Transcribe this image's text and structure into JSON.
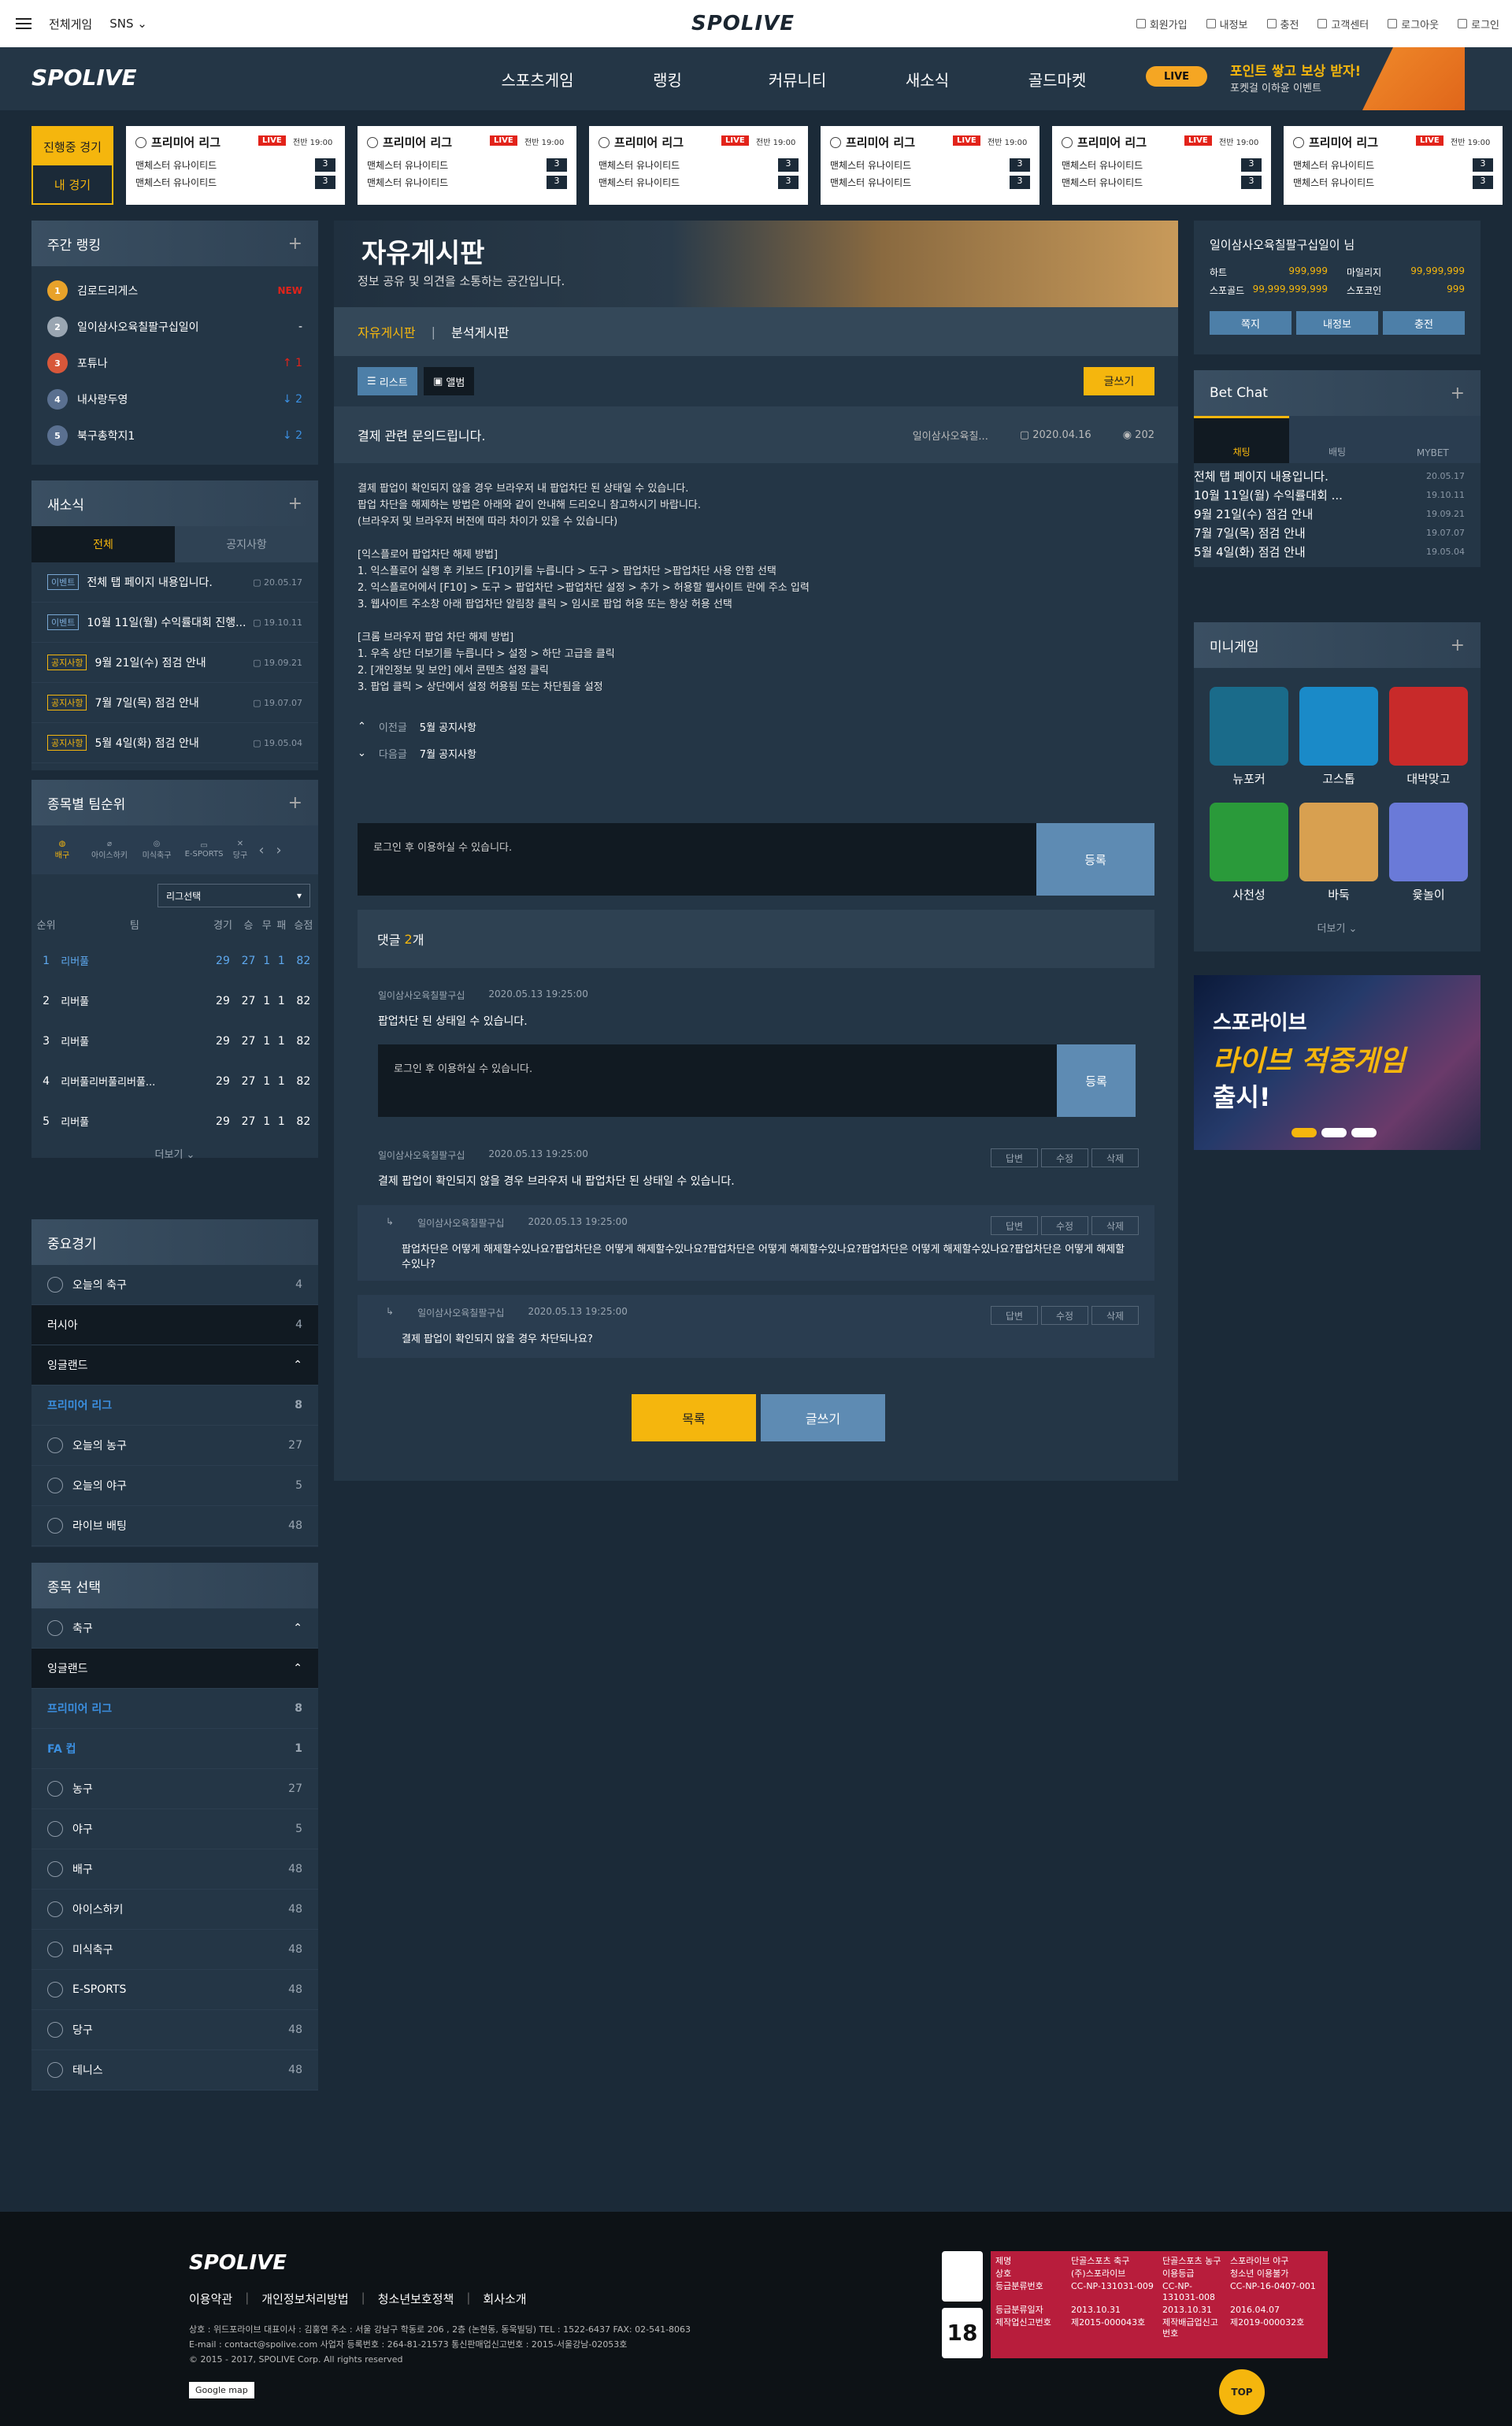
{
  "header": {
    "menu_all": "전체게임",
    "menu_sns": "SNS",
    "logo": "SPOLIVE",
    "links": [
      "회원가입",
      "내정보",
      "충전",
      "고객센터",
      "로그아웃",
      "로그인"
    ]
  },
  "nav": {
    "logo": "SPOLIVE",
    "items": [
      "스포츠게임",
      "랭킹",
      "커뮤니티",
      "새소식",
      "골드마켓"
    ],
    "live": "LIVE",
    "promo_title": "포인트 쌓고 보상 받자!",
    "promo_sub": "포켓걸 이하윤 이벤트"
  },
  "livegames": {
    "tab_live": "진행중 경기",
    "tab_mine": "내 경기",
    "cards": [
      {
        "league": "프리미어 리그",
        "live": "LIVE",
        "time": "전반 19:00",
        "home": "맨체스터 유나이티드",
        "away": "맨체스터 유나이티드",
        "hs": "3",
        "as": "3"
      },
      {
        "league": "프리미어 리그",
        "live": "LIVE",
        "time": "전반 19:00",
        "home": "맨체스터 유나이티드",
        "away": "맨체스터 유나이티드",
        "hs": "3",
        "as": "3"
      },
      {
        "league": "프리미어 리그",
        "live": "LIVE",
        "time": "전반 19:00",
        "home": "맨체스터 유나이티드",
        "away": "맨체스터 유나이티드",
        "hs": "3",
        "as": "3"
      },
      {
        "league": "프리미어 리그",
        "live": "LIVE",
        "time": "전반 19:00",
        "home": "맨체스터 유나이티드",
        "away": "맨체스터 유나이티드",
        "hs": "3",
        "as": "3"
      },
      {
        "league": "프리미어 리그",
        "live": "LIVE",
        "time": "전반 19:00",
        "home": "맨체스터 유나이티드",
        "away": "맨체스터 유나이티드",
        "hs": "3",
        "as": "3"
      },
      {
        "league": "프리미어 리그",
        "live": "LIVE",
        "time": "전반 19:00",
        "home": "맨체스터 유나이티드",
        "away": "맨체스터 유나이티드",
        "hs": "3",
        "as": "3"
      }
    ]
  },
  "weekly": {
    "title": "주간 랭킹",
    "rows": [
      {
        "n": "1",
        "name": "김로드리게스",
        "ch": "NEW"
      },
      {
        "n": "2",
        "name": "일이삼사오육칠팔구십일이",
        "ch": "-"
      },
      {
        "n": "3",
        "name": "포튜나",
        "ch": "↑ 1"
      },
      {
        "n": "4",
        "name": "내사랑두영",
        "ch": "↓ 2"
      },
      {
        "n": "5",
        "name": "북구총학지1",
        "ch": "↓ 2"
      }
    ]
  },
  "news": {
    "title": "새소식",
    "tab_all": "전체",
    "tab_notice": "공지사항",
    "rows": [
      {
        "badge": "이벤트",
        "title": "전체 탭 페이지 내용입니다.",
        "date": "20.05.17"
      },
      {
        "badge": "이벤트",
        "title": "10월 11일(월) 수익률대회 진행...",
        "date": "19.10.11"
      },
      {
        "badge": "공지사항",
        "title": "9월 21일(수) 점검 안내",
        "date": "19.09.21"
      },
      {
        "badge": "공지사항",
        "title": "7월 7일(목) 점검 안내",
        "date": "19.07.07"
      },
      {
        "badge": "공지사항",
        "title": "5월 4일(화) 점검 안내",
        "date": "19.05.04"
      }
    ]
  },
  "teamrank": {
    "title": "종목별 팀순위",
    "sports": [
      "배구",
      "아이스하키",
      "미식축구",
      "E-SPORTS",
      "당구"
    ],
    "select": "리그선택",
    "cols": [
      "순위",
      "팀",
      "경기",
      "승",
      "무",
      "패",
      "승점"
    ],
    "rows": [
      [
        "1",
        "리버풀",
        "29",
        "27",
        "1",
        "1",
        "82"
      ],
      [
        "2",
        "리버풀",
        "29",
        "27",
        "1",
        "1",
        "82"
      ],
      [
        "3",
        "리버풀",
        "29",
        "27",
        "1",
        "1",
        "82"
      ],
      [
        "4",
        "리버풀리버풀리버풀...",
        "29",
        "27",
        "1",
        "1",
        "82"
      ],
      [
        "5",
        "리버풀",
        "29",
        "27",
        "1",
        "1",
        "82"
      ]
    ],
    "more": "더보기"
  },
  "important": {
    "title": "중요경기",
    "rows": [
      {
        "n": "오늘의 축구",
        "c": "4"
      },
      {
        "n": "러시아",
        "c": "4"
      },
      {
        "n": "잉글랜드",
        "c": ""
      },
      {
        "n": "프리미어 리그",
        "c": "8"
      },
      {
        "n": "오늘의 농구",
        "c": "27"
      },
      {
        "n": "오늘의 야구",
        "c": "5"
      },
      {
        "n": "라이브 배팅",
        "c": "48"
      }
    ]
  },
  "sportsel": {
    "title": "종목 선택",
    "rows": [
      {
        "n": "축구",
        "c": ""
      },
      {
        "n": "잉글랜드",
        "c": ""
      },
      {
        "n": "프리미어 리그",
        "c": "8"
      },
      {
        "n": "FA 컵",
        "c": "1"
      },
      {
        "n": "농구",
        "c": "27"
      },
      {
        "n": "야구",
        "c": "5"
      },
      {
        "n": "배구",
        "c": "48"
      },
      {
        "n": "아이스하키",
        "c": "48"
      },
      {
        "n": "미식축구",
        "c": "48"
      },
      {
        "n": "E-SPORTS",
        "c": "48"
      },
      {
        "n": "당구",
        "c": "48"
      },
      {
        "n": "테니스",
        "c": "48"
      }
    ]
  },
  "board": {
    "title": "자유게시판",
    "desc": "정보 공유 및 의견을 소통하는 공간입니다.",
    "tab1": "자유게시판",
    "tab2": "분석게시판",
    "list": "리스트",
    "album": "앨범",
    "write": "글쓰기",
    "post_title": "결제 관련 문의드립니다.",
    "post_author": "일이삼사오육칠...",
    "post_date": "2020.04.16",
    "post_views": "202",
    "body": "결제 팝업이 확인되지 않을 경우 브라우저 내 팝업차단 된 상태일 수 있습니다.\n팝업 차단을 해제하는 방법은 아래와 같이 안내해 드리오니 참고하시기 바랍니다.\n(브라우저 및 브라우저 버전에 따라 차이가 있을 수 있습니다)\n\n[익스플로어 팝업차단 해제 방법]\n1. 익스플로어 실행 후 키보드 [F10]키를 누릅니다 > 도구 > 팝업차단 >팝업차단 사용 안함 선택\n2. 익스플로어에서 [F10] > 도구 > 팝업차단 >팝업차단 설정 > 추가 > 허용할 웹사이트 란에 주소 입력\n3. 웹사이트 주소창 아래 팝업차단 알림창 클릭 > 임시로 팝업 허용 또는 항상 허용 선택\n\n[크롬 브라우저 팝업 차단 해제 방법]\n1. 우측 상단 더보기를 누릅니다 > 설정 > 하단 고급을 클릭\n2. [개인정보 및 보안] 에서 콘텐츠 설정 클릭\n3. 팝업 클릭 > 상단에서 설정 허용됨 또는 차단됨을 설정",
    "prev_k": "이전글",
    "prev": "5월 공지사항",
    "next_k": "다음글",
    "next": "7월 공지사항",
    "cmt_ph": "로그인 후 이용하실 수 있습니다.",
    "cmt_btn": "등록",
    "cmt_label": "댓글",
    "cmt_n": "2",
    "cmt_unit": "개",
    "c1_author": "일이삼사오육칠팔구십",
    "c1_date": "2020.05.13 19:25:00",
    "c1_text": "팝업차단 된 상태일 수 있습니다.",
    "c2_author": "일이삼사오육칠팔구십",
    "c2_date": "2020.05.13 19:25:00",
    "c2_text": "결제 팝업이 확인되지 않을 경우 브라우저 내 팝업차단 된 상태일 수 있습니다.",
    "c3_author": "일이삼사오육칠팔구십",
    "c3_date": "2020.05.13 19:25:00",
    "c3_text": "팝업차단은 어떻게 해제할수있나요?팝업차단은 어떻게 해제할수있나요?팝업차단은 어떻게 해제할수있나요?팝업차단은 어떻게 해제할수있나요?팝업차단은 어떻게 해제할 수있나?",
    "c4_author": "일이삼사오육칠팔구십",
    "c4_date": "2020.05.13 19:25:00",
    "c4_text": "결제 팝업이 확인되지 않을 경우 차단되나요?",
    "b_reply": "답변",
    "b_edit": "수정",
    "b_del": "삭제",
    "btn_list": "목록",
    "btn_write": "글쓰기"
  },
  "user": {
    "name": "일이삼사오육칠팔구십일이 님",
    "p1k": "하트",
    "p1": "999,999",
    "p2k": "마일리지",
    "p2": "99,999,999",
    "p3k": "스포골드",
    "p3": "99,999,999,999",
    "p4k": "스포코인",
    "p4": "999",
    "btns": [
      "쪽지",
      "내정보",
      "충전"
    ]
  },
  "betchat": {
    "title": "Bet Chat",
    "tabs": [
      "채팅",
      "배팅",
      "MYBET"
    ],
    "rows": [
      {
        "t": "전체 탭 페이지 내용입니다.",
        "d": "20.05.17"
      },
      {
        "t": "10월 11일(월) 수익률대회 ...",
        "d": "19.10.11"
      },
      {
        "t": "9월 21일(수) 점검 안내",
        "d": "19.09.21"
      },
      {
        "t": "7월 7일(목) 점검 안내",
        "d": "19.07.07"
      },
      {
        "t": "5월 4일(화) 점검 안내",
        "d": "19.05.04"
      }
    ]
  },
  "minigame": {
    "title": "미니게임",
    "items": [
      "뉴포커",
      "고스톱",
      "대박맞고",
      "사천성",
      "바둑",
      "윷놀이"
    ],
    "more": "더보기",
    "colors": [
      "#1a6b8a",
      "#1a8ac8",
      "#c82a2a",
      "#2a9a3a",
      "#d8a050",
      "#6a7ad8"
    ]
  },
  "ad": {
    "t1": "스포라이브",
    "t2": "라이브 적중게임",
    "t3": "출시!"
  },
  "footer": {
    "logo": "SPOLIVE",
    "links": [
      "이용약관",
      "개인정보처리방법",
      "청소년보호정책",
      "회사소개"
    ],
    "info1": "상호 : 위드포라이브 대표이사 : 김홍연 주소 : 서울 강남구 학동로 206 , 2층 (논현동, 동욱빌딩) TEL : 1522-6437 FAX: 02-541-8063",
    "info2": "E-mail : contact@spolive.com 사업자 등록번호 : 264-81-21573 통신판매업신고번호 : 2015-서울강남-02053호",
    "info3": "© 2015 - 2017, SPOLIVE Corp. All rights reserved",
    "gmap": "Google map",
    "top": "TOP",
    "rating": [
      "제명",
      "단골스포츠 축구",
      "단골스포츠 농구",
      "스포라이브 야구",
      "상호",
      "(주)스포라이브",
      "이용등급",
      "청소년 이용불가",
      "등급분류번호",
      "CC-NP-131031-009",
      "CC-NP-131031-008",
      "CC-NP-16-0407-001",
      "등급분류일자",
      "2013.10.31",
      "2013.10.31",
      "2016.04.07",
      "제작업신고번호",
      "제2015-000043호",
      "제작배급업신고번호",
      "제2019-000032호"
    ]
  }
}
